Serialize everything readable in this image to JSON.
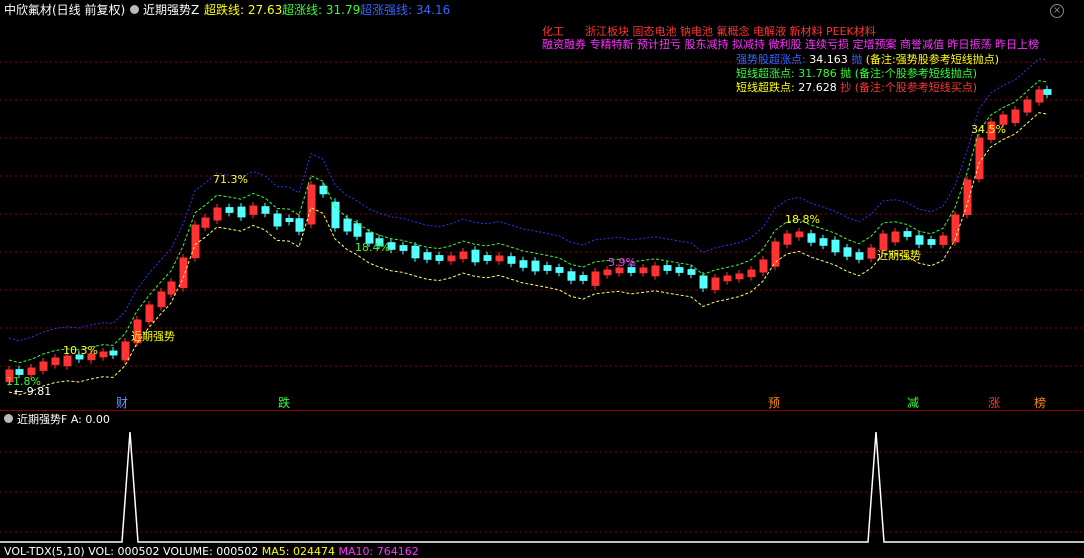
{
  "header": {
    "stock": "中欣氟材(日线 前复权)",
    "indicator": "近期强势Z",
    "items": [
      {
        "label": "超跌线:",
        "value": "27.63",
        "color": "#ffff00"
      },
      {
        "label": "超涨线:",
        "value": "31.79",
        "color": "#33ff33"
      },
      {
        "label": "超涨强线:",
        "value": "34.16",
        "color": "#3366ff"
      }
    ]
  },
  "concepts": {
    "line1": [
      "化工",
      "浙江板块",
      "固态电池",
      "钠电池",
      "氟概念",
      "电解液",
      "新材料",
      "PEEK材料"
    ],
    "line2": [
      "融资融券",
      "专精特新",
      "预计扭亏",
      "股东减持",
      "拟减持",
      "微利股",
      "连续亏损",
      "定增预案",
      "商誉减值",
      "昨日振荡",
      "昨日上榜"
    ]
  },
  "info_rows": [
    {
      "label": "强势股超涨点:",
      "value": "34.163",
      "action": "抛",
      "note": "(备注:强势股参考短线抛点)",
      "color": "#3366ff"
    },
    {
      "label": "短线超涨点:",
      "value": "31.786",
      "action": "抛",
      "note": "(备注:个股参考短线抛点)",
      "color": "#33ff33"
    },
    {
      "label": "短线超跌点:",
      "value": "27.628",
      "action": "抄",
      "note": "(备注:个股参考短线买点)",
      "color": "#ffff00"
    }
  ],
  "annotations": {
    "pct": [
      "71.3%",
      "10.3%",
      "11.8%",
      "18.4%",
      "5.9%",
      "18.8%",
      "34.5%"
    ],
    "strong": [
      "近期强势",
      "近期强势"
    ],
    "low_price": "9.81"
  },
  "bottom_tags": [
    {
      "text": "财",
      "color": "#6699ff"
    },
    {
      "text": "跌",
      "color": "#33ff33"
    },
    {
      "text": "预",
      "color": "#ff8800"
    },
    {
      "text": "减",
      "color": "#33ff33"
    },
    {
      "text": "涨",
      "color": "#ff3333"
    },
    {
      "text": "榜",
      "color": "#ff8800"
    }
  ],
  "sub_panel": {
    "title": "近期强势F",
    "value_label": "A: 0.00",
    "signal_values": [
      0,
      1,
      0,
      1,
      0
    ]
  },
  "footer": {
    "label": "VOL-TDX(5,10)",
    "items": [
      "VOL: 000502",
      "VOLUME: 000502",
      "MA5: 024474",
      "MA10: 764162"
    ]
  },
  "colors": {
    "up": "#ff3333",
    "down": "#54ffff",
    "upper_band": "#3333ff",
    "mid_band": "#33ff33",
    "low_band": "#ffff66",
    "grid": "#8b0000",
    "magenta": "#ff33ff"
  },
  "icons": [
    "settings-dot-icon",
    "close-icon"
  ]
}
